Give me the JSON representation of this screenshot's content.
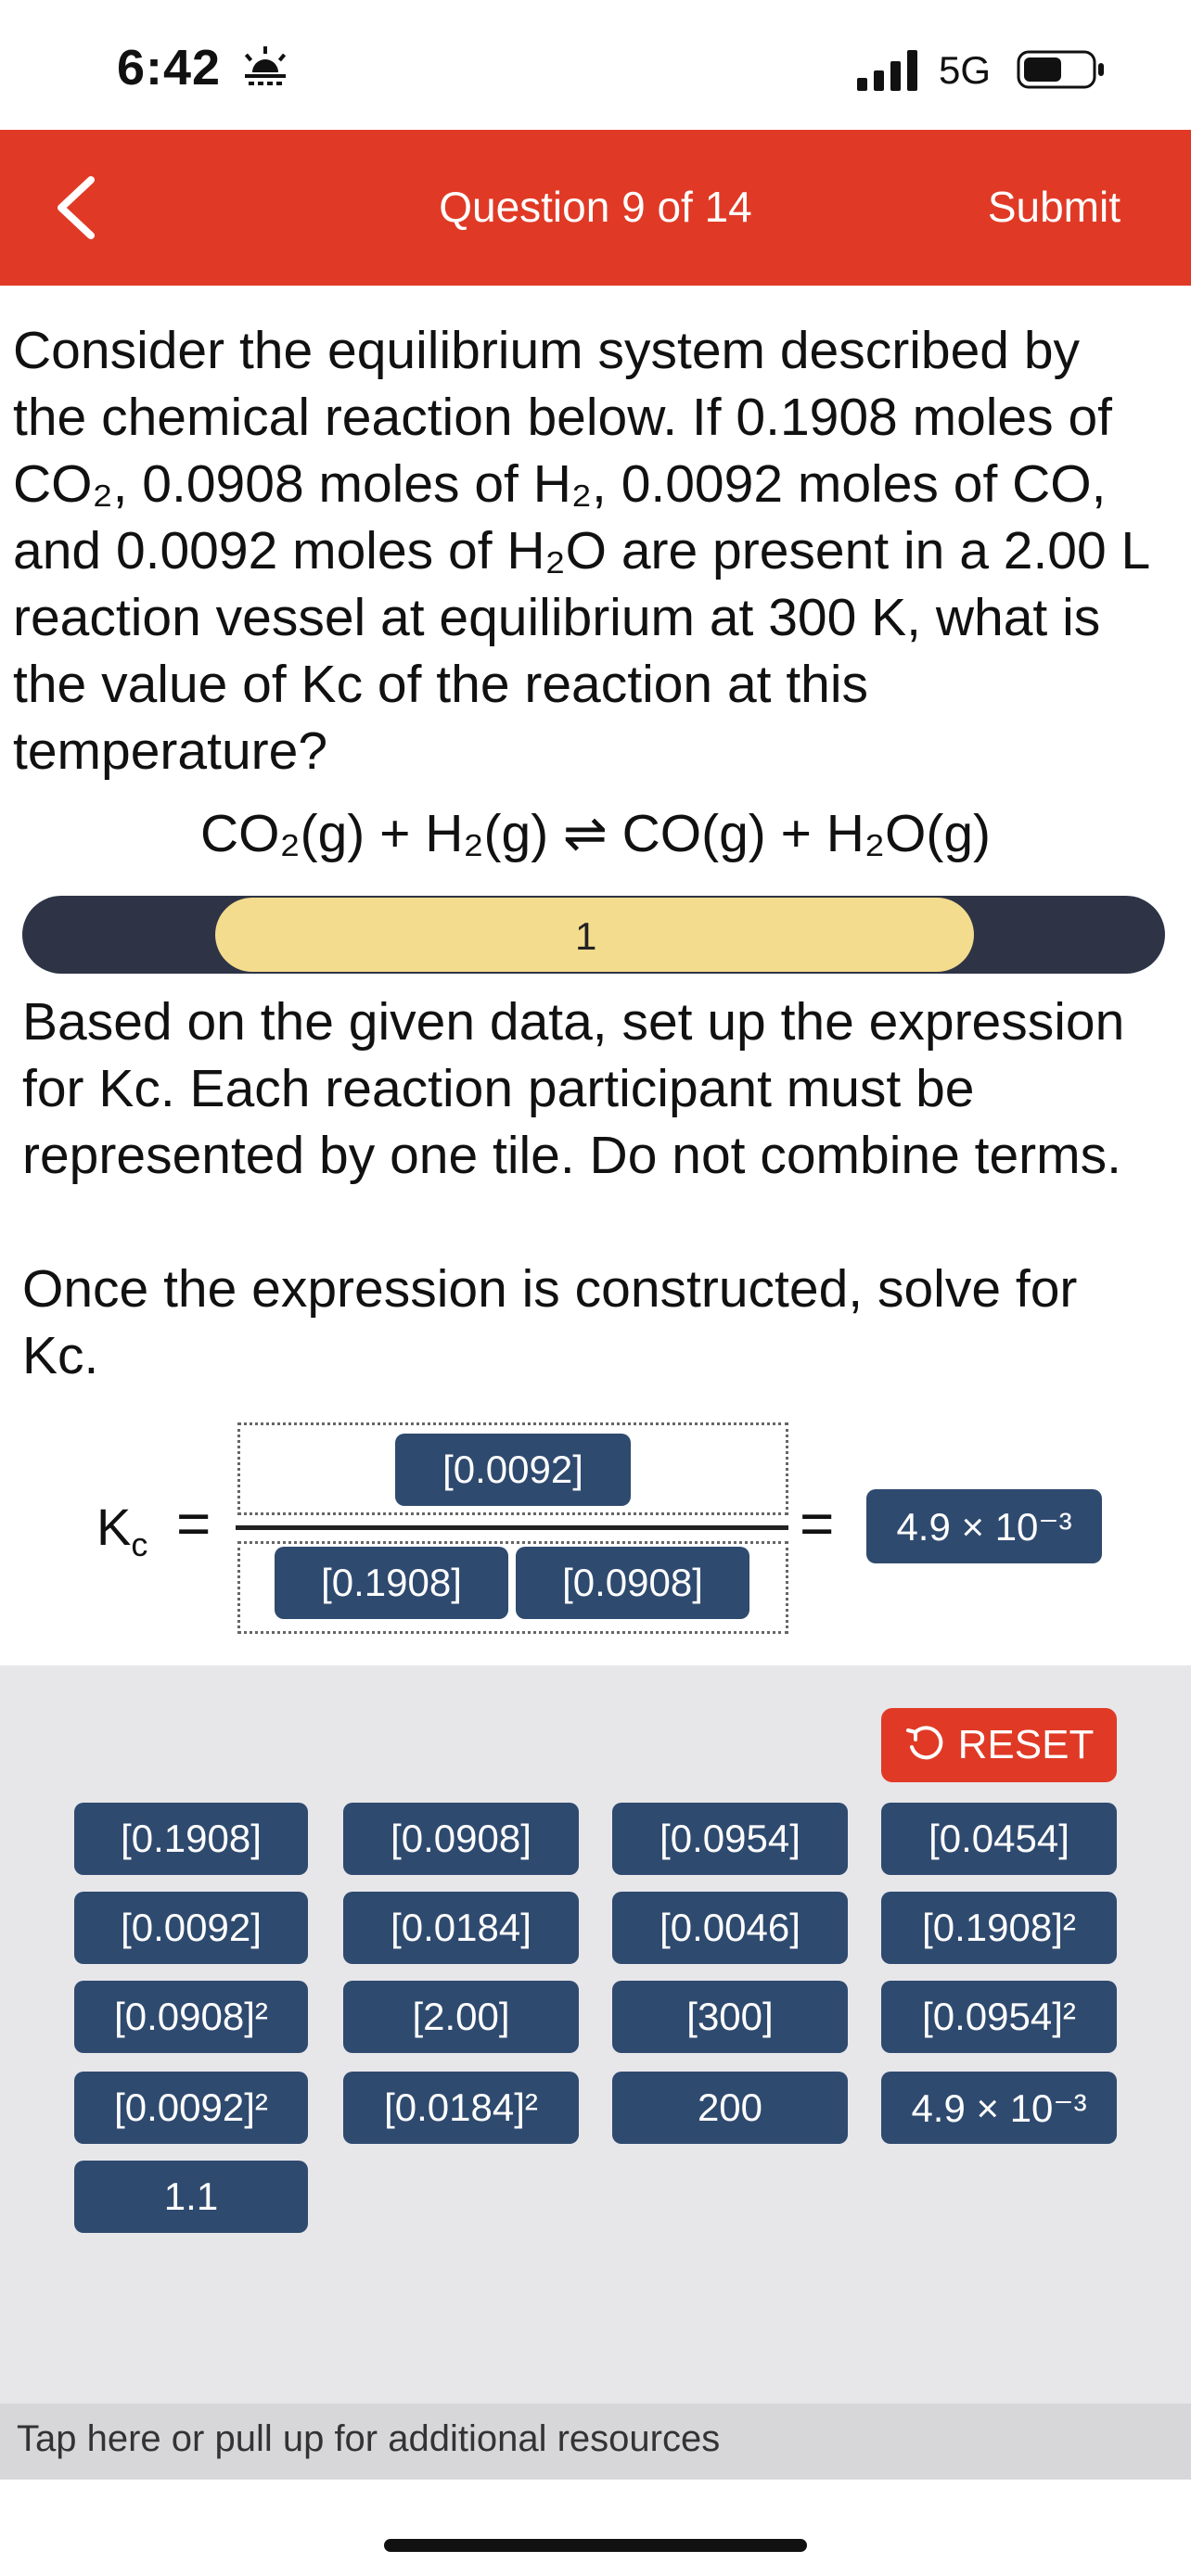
{
  "status_bar": {
    "time": "6:42",
    "network": "5G",
    "icons": [
      "alarm-icon",
      "signal-icon",
      "battery-icon"
    ]
  },
  "header": {
    "title": "Question 9 of 14",
    "submit_label": "Submit",
    "color": "#e03a26"
  },
  "question": {
    "lines": [
      "Consider the equilibrium system described by",
      "the chemical reaction below. If 0.1908 moles of",
      "CO₂, 0.0908 moles of H₂, 0.0092 moles of CO,",
      "and 0.0092 moles of H₂O are present in a 2.00 L",
      "reaction vessel at equilibrium at 300 K, what is",
      "the value of Kc of the reaction at this",
      "temperature?"
    ],
    "reaction": "CO₂(g) + H₂(g) ⇌ CO(g) + H₂O(g)"
  },
  "progress": {
    "step_label": "1",
    "fill_fraction": 0.66
  },
  "instructions": {
    "lines": [
      "Based on the given data, set up the expression",
      "for Kc. Each reaction participant must be",
      "represented by one tile. Do not combine terms."
    ],
    "lines2": [
      "Once the expression is constructed, solve for",
      "Kc."
    ]
  },
  "expression": {
    "kc_label": "K",
    "kc_sub": "c",
    "equals": "=",
    "numerator": [
      "[0.0092]"
    ],
    "denominator": [
      "[0.1908]",
      "[0.0908]"
    ],
    "result": "4.9 × 10⁻³"
  },
  "tray": {
    "reset_label": "RESET",
    "tiles": [
      "[0.1908]",
      "[0.0908]",
      "[0.0954]",
      "[0.0454]",
      "[0.0092]",
      "[0.0184]",
      "[0.0046]",
      "[0.1908]²",
      "[0.0908]²",
      "[2.00]",
      "[300]",
      "[0.0954]²",
      "[0.0092]²",
      "[0.0184]²",
      "200",
      "4.9 × 10⁻³",
      "1.1"
    ]
  },
  "resources": {
    "label": "Tap here or pull up for additional resources"
  },
  "colors": {
    "accent": "#e03a26",
    "tile": "#2f4a6f",
    "progress_track": "#2e3446",
    "progress_fill": "#f4dc8e",
    "tray_bg": "#e7e7ea"
  }
}
